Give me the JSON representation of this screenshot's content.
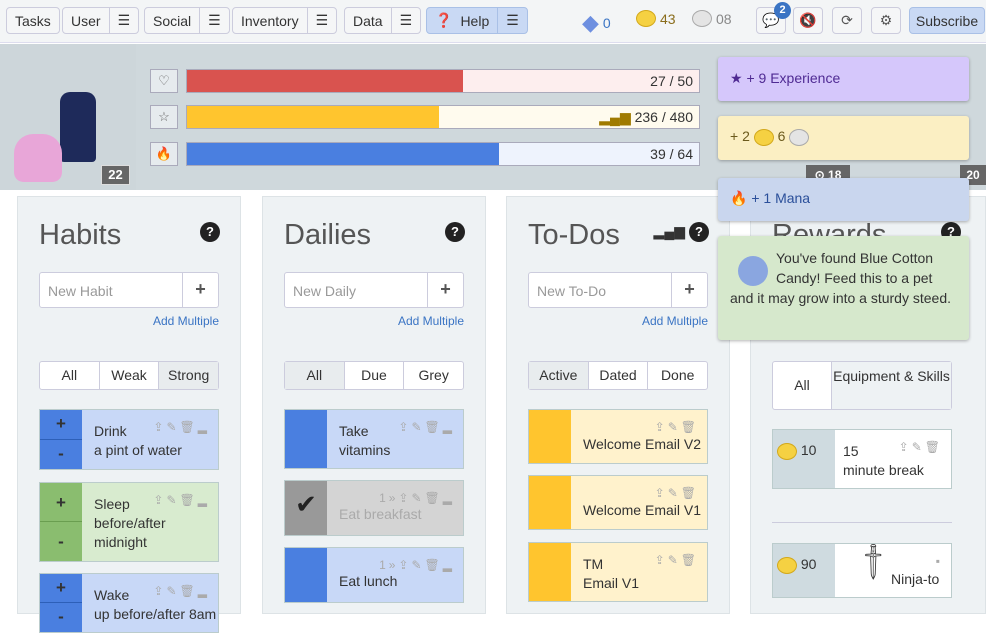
{
  "nav": {
    "tasks": "Tasks",
    "user": "User",
    "social": "Social",
    "inventory": "Inventory",
    "data": "Data",
    "help": "Help",
    "menu_icon": "☰"
  },
  "currency": {
    "gems": "0",
    "gold": "43",
    "silver": "08"
  },
  "toolbar": {
    "chat_badge": "2",
    "subscribe": "Subscribe"
  },
  "stats": {
    "health": {
      "text": "27 / 50",
      "value": 27,
      "max": 50,
      "color": "#d9534f"
    },
    "experience": {
      "text": "236 / 480",
      "value": 236,
      "max": 480,
      "color": "#ffc52e"
    },
    "mana": {
      "text": "39 / 64",
      "value": 39,
      "max": 64,
      "color": "#4a7fe0"
    },
    "level": "22"
  },
  "party": {
    "level1": "18",
    "level2": "20"
  },
  "notifications": {
    "exp": "+ 9 Experience",
    "gold_prefix": "+ 2",
    "gold_silver": "6",
    "mana": "+ 1 Mana",
    "drop": "You've found Blue Cotton Candy! Feed this to a pet and it may grow into a sturdy steed."
  },
  "habits": {
    "title": "Habits",
    "placeholder": "New Habit",
    "add_multiple": "Add Multiple",
    "filters": [
      "All",
      "Weak",
      "Strong"
    ],
    "items": [
      {
        "line1": "Drink",
        "line2": "a pint of water"
      },
      {
        "line1": "Sleep",
        "line2": "before/after",
        "line3": "midnight"
      },
      {
        "line1": "Wake",
        "line2": "up before/after 8am"
      }
    ]
  },
  "dailies": {
    "title": "Dailies",
    "placeholder": "New Daily",
    "add_multiple": "Add Multiple",
    "filters": [
      "All",
      "Due",
      "Grey"
    ],
    "items": [
      {
        "line1": "Take",
        "line2": "vitamins"
      },
      {
        "line1": "Eat breakfast",
        "streak": "1"
      },
      {
        "line1": "Eat lunch",
        "streak": "1"
      }
    ]
  },
  "todos": {
    "title": "To-Dos",
    "placeholder": "New To-Do",
    "add_multiple": "Add Multiple",
    "filters": [
      "Active",
      "Dated",
      "Done"
    ],
    "items": [
      {
        "line1": "Welcome Email V2"
      },
      {
        "line1": "Welcome Email V1"
      },
      {
        "line1": "TM",
        "line2": "Email V1"
      }
    ]
  },
  "rewards": {
    "title": "Rewards",
    "filters": [
      "All",
      "Equipment & Skills"
    ],
    "items": [
      {
        "price": "10",
        "line1": "15",
        "line2": "minute break"
      },
      {
        "price": "90",
        "line1": "Ninja-to"
      }
    ]
  }
}
